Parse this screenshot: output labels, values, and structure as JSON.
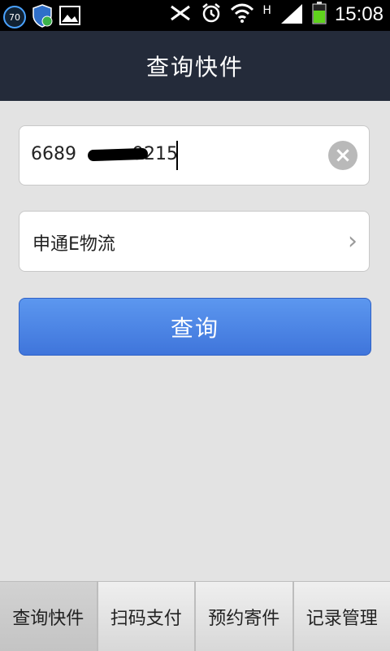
{
  "status_bar": {
    "badge": "70",
    "network": "H",
    "time": "15:08"
  },
  "header": {
    "title": "查询快件"
  },
  "tracking": {
    "value_prefix": "6689",
    "value_suffix": "9215",
    "clear_icon": "clear-icon"
  },
  "courier": {
    "label": "申通E物流",
    "chevron_icon": "chevron-right-icon"
  },
  "actions": {
    "query_label": "查询"
  },
  "tabs": [
    {
      "label": "查询快件",
      "active": true
    },
    {
      "label": "扫码支付",
      "active": false
    },
    {
      "label": "预约寄件",
      "active": false
    },
    {
      "label": "记录管理",
      "active": false
    }
  ],
  "colors": {
    "header_bg": "#242b3a",
    "button_blue": "#4a83e4",
    "page_bg": "#e3e3e3"
  }
}
